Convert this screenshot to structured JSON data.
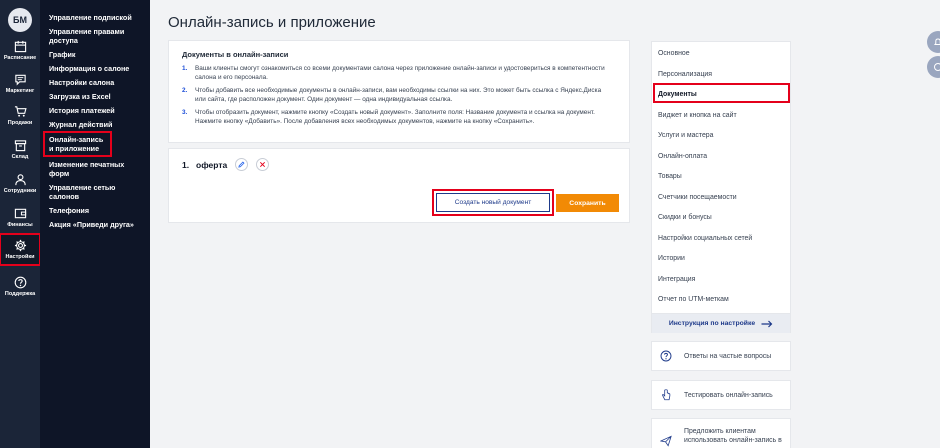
{
  "user": {
    "initials": "БМ"
  },
  "rail": [
    {
      "label": "Расписание",
      "icon": "calendar-icon"
    },
    {
      "label": "Маркетинг",
      "icon": "chat-icon"
    },
    {
      "label": "Продажи",
      "icon": "cart-icon"
    },
    {
      "label": "Склад",
      "icon": "box-icon"
    },
    {
      "label": "Сотрудники",
      "icon": "person-icon"
    },
    {
      "label": "Финансы",
      "icon": "wallet-icon"
    },
    {
      "label": "Настройки",
      "icon": "gear-icon",
      "selected": true
    },
    {
      "label": "Поддержка",
      "icon": "question-icon"
    }
  ],
  "subnav": [
    "Управление подпиской",
    "Управление правами доступа",
    "График",
    "Информация о салоне",
    "Настройки салона",
    "Загрузка из Excel",
    "История платежей",
    "Журнал действий",
    "Онлайн-запись и приложение",
    "Изменение печатных форм",
    "Управление сетью салонов",
    "Телефония",
    "Акция «Приведи друга»"
  ],
  "page": {
    "title": "Онлайн-запись и приложение"
  },
  "docs": {
    "title": "Документы в онлайн-записи",
    "steps": [
      {
        "num": "1.",
        "text": "Ваши клиенты смогут ознакомиться со всеми документами салона через приложение онлайн-записи и удостовериться в компетентности салона и его персонала."
      },
      {
        "num": "2.",
        "text": "Чтобы добавить все необходимые документы в онлайн-записи, вам необходимы ссылки на них. Это может быть ссылка с Яндекс.Диска или сайта, где расположен документ. Один документ — одна индивидуальная ссылка."
      },
      {
        "num": "3.",
        "text": "Чтобы отобразить документ, нажмите кнопку «Создать новый документ». Заполните поля: Название документа и ссылка на документ. Нажмите кнопку «Добавить». После добавления всех необходимых документов, нажмите на кнопку «Сохранить»."
      }
    ]
  },
  "document_list": [
    {
      "num": "1.",
      "name": "оферта"
    }
  ],
  "actions": {
    "create": "Создать новый документ",
    "save": "Сохранить"
  },
  "settings_menu": [
    "Основное",
    "Персонализация",
    "Документы",
    "Виджет и кнопка на сайт",
    "Услуги и мастера",
    "Онлайн-оплата",
    "Товары",
    "Счетчики посещаемости",
    "Скидки и бонусы",
    "Настройки социальных сетей",
    "Истории",
    "Интеграция",
    "Отчет по UTM-меткам"
  ],
  "guide": {
    "label": "Инструкция по настройке"
  },
  "aux": {
    "faq": "Ответы на частые вопросы",
    "test": "Тестировать онлайн-запись",
    "suggest": "Предложить клиентам использовать онлайн-запись в"
  },
  "colors": {
    "sidebar": "#0e1527",
    "rail": "#1b2538",
    "accent": "#f28a05",
    "highlight": "#e4001b",
    "brand_blue": "#1e3a8a"
  }
}
